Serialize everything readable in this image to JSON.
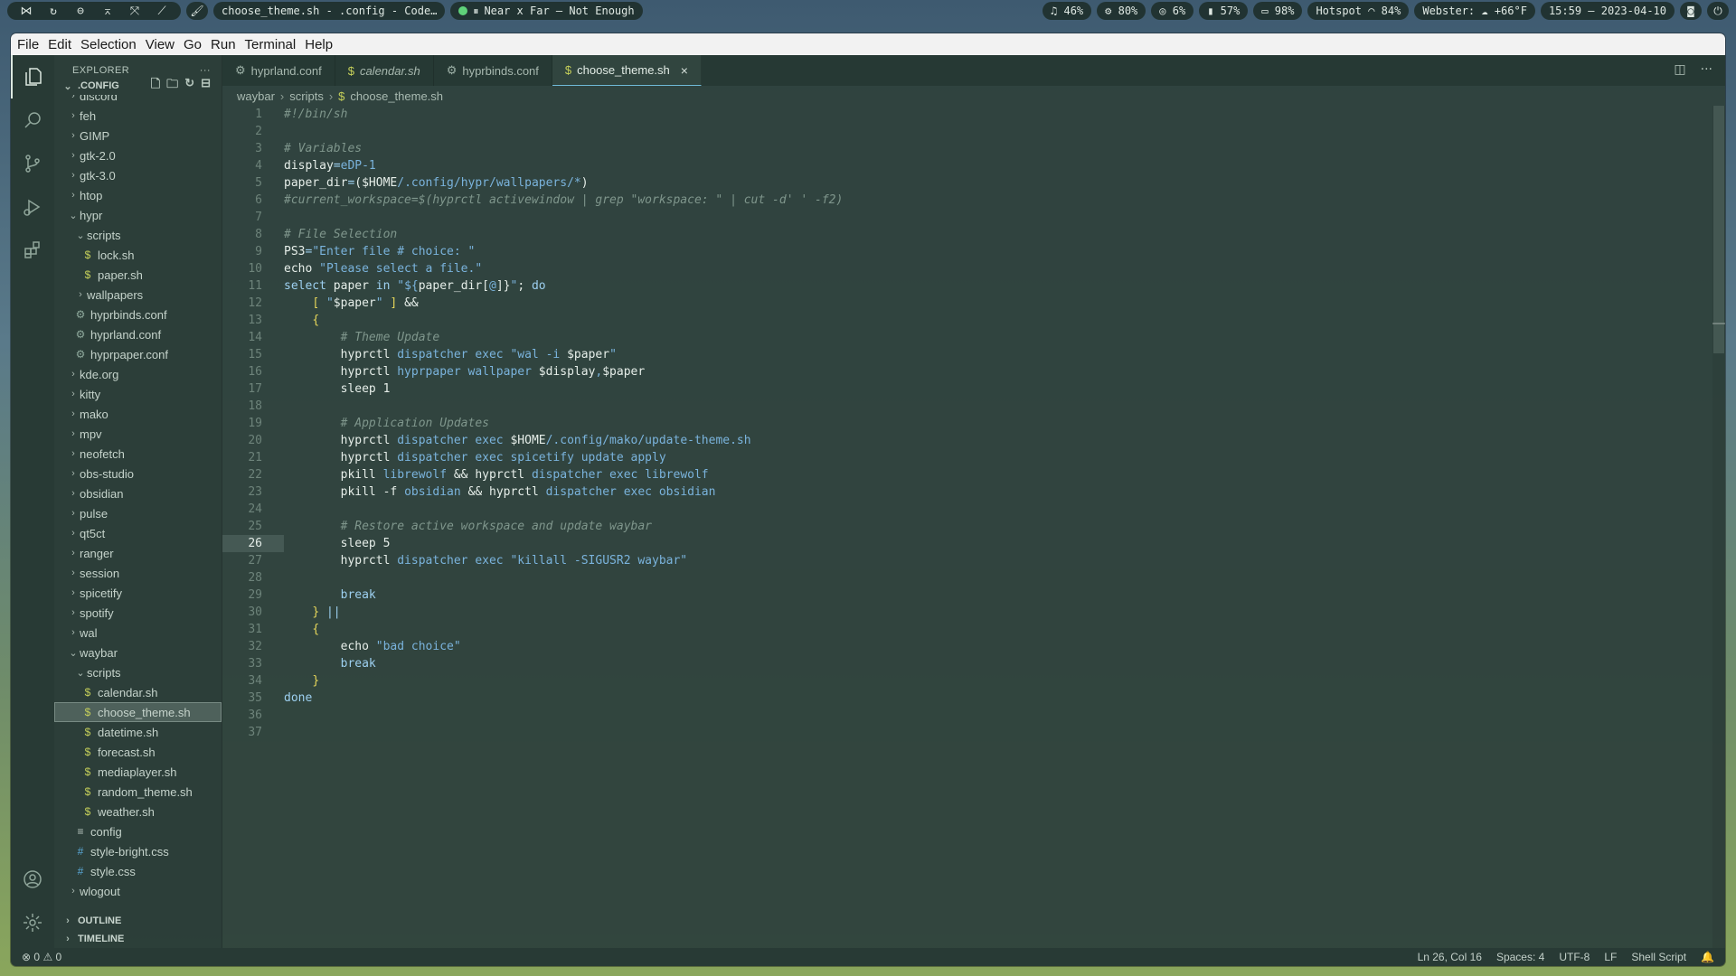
{
  "topbar": {
    "left_icons": [
      "arch-logo-icon",
      "refresh-icon",
      "spotify-icon",
      "tool-icon",
      "tools-icon",
      "pen-icon"
    ],
    "brush_icon": "brush-icon",
    "window_title": "choose_theme.sh - .config - Code…",
    "media_label": "Near x Far – Not Enough",
    "status": [
      {
        "icon": "headphones-icon",
        "label": "♫ 46%"
      },
      {
        "icon": "cpu-icon",
        "label": "⚙ 80%"
      },
      {
        "icon": "gpu-icon",
        "label": "◎ 6%"
      },
      {
        "icon": "memory-icon",
        "label": "▮ 57%"
      },
      {
        "icon": "battery-icon",
        "label": "▭ 98%"
      },
      {
        "icon": "wifi-icon",
        "label": "Hotspot ◠ 84%"
      },
      {
        "icon": "weather-icon",
        "label": "Webster: ☁ +66°F"
      },
      {
        "icon": "clock-icon",
        "label": "15:59 – 2023-04-10"
      }
    ],
    "discord_icon": "discord-icon",
    "power_icon": "power-icon"
  },
  "menu": [
    "File",
    "Edit",
    "Selection",
    "View",
    "Go",
    "Run",
    "Terminal",
    "Help"
  ],
  "sidebar": {
    "title": "EXPLORER",
    "root": ".CONFIG",
    "tree": [
      {
        "label": "discord",
        "type": "folder",
        "indent": 0,
        "open": false
      },
      {
        "label": "feh",
        "type": "folder",
        "indent": 0,
        "open": false
      },
      {
        "label": "GIMP",
        "type": "folder",
        "indent": 0,
        "open": false
      },
      {
        "label": "gtk-2.0",
        "type": "folder",
        "indent": 0,
        "open": false
      },
      {
        "label": "gtk-3.0",
        "type": "folder",
        "indent": 0,
        "open": false
      },
      {
        "label": "htop",
        "type": "folder",
        "indent": 0,
        "open": false
      },
      {
        "label": "hypr",
        "type": "folder",
        "indent": 0,
        "open": true
      },
      {
        "label": "scripts",
        "type": "folder",
        "indent": 1,
        "open": true
      },
      {
        "label": "lock.sh",
        "type": "sh",
        "indent": 2
      },
      {
        "label": "paper.sh",
        "type": "sh",
        "indent": 2
      },
      {
        "label": "wallpapers",
        "type": "folder",
        "indent": 1,
        "open": false
      },
      {
        "label": "hyprbinds.conf",
        "type": "conf",
        "indent": 1
      },
      {
        "label": "hyprland.conf",
        "type": "conf",
        "indent": 1
      },
      {
        "label": "hyprpaper.conf",
        "type": "conf",
        "indent": 1
      },
      {
        "label": "kde.org",
        "type": "folder",
        "indent": 0,
        "open": false
      },
      {
        "label": "kitty",
        "type": "folder",
        "indent": 0,
        "open": false
      },
      {
        "label": "mako",
        "type": "folder",
        "indent": 0,
        "open": false
      },
      {
        "label": "mpv",
        "type": "folder",
        "indent": 0,
        "open": false
      },
      {
        "label": "neofetch",
        "type": "folder",
        "indent": 0,
        "open": false
      },
      {
        "label": "obs-studio",
        "type": "folder",
        "indent": 0,
        "open": false
      },
      {
        "label": "obsidian",
        "type": "folder",
        "indent": 0,
        "open": false
      },
      {
        "label": "pulse",
        "type": "folder",
        "indent": 0,
        "open": false
      },
      {
        "label": "qt5ct",
        "type": "folder",
        "indent": 0,
        "open": false
      },
      {
        "label": "ranger",
        "type": "folder",
        "indent": 0,
        "open": false
      },
      {
        "label": "session",
        "type": "folder",
        "indent": 0,
        "open": false
      },
      {
        "label": "spicetify",
        "type": "folder",
        "indent": 0,
        "open": false
      },
      {
        "label": "spotify",
        "type": "folder",
        "indent": 0,
        "open": false
      },
      {
        "label": "wal",
        "type": "folder",
        "indent": 0,
        "open": false
      },
      {
        "label": "waybar",
        "type": "folder",
        "indent": 0,
        "open": true
      },
      {
        "label": "scripts",
        "type": "folder",
        "indent": 1,
        "open": true
      },
      {
        "label": "calendar.sh",
        "type": "sh",
        "indent": 2
      },
      {
        "label": "choose_theme.sh",
        "type": "sh",
        "indent": 2,
        "selected": true
      },
      {
        "label": "datetime.sh",
        "type": "sh",
        "indent": 2
      },
      {
        "label": "forecast.sh",
        "type": "sh",
        "indent": 2
      },
      {
        "label": "mediaplayer.sh",
        "type": "sh",
        "indent": 2
      },
      {
        "label": "random_theme.sh",
        "type": "sh",
        "indent": 2
      },
      {
        "label": "weather.sh",
        "type": "sh",
        "indent": 2
      },
      {
        "label": "config",
        "type": "txt",
        "indent": 1
      },
      {
        "label": "style-bright.css",
        "type": "css",
        "indent": 1
      },
      {
        "label": "style.css",
        "type": "css",
        "indent": 1
      },
      {
        "label": "wlogout",
        "type": "folder",
        "indent": 0,
        "open": false
      }
    ],
    "outline": "OUTLINE",
    "timeline": "TIMELINE"
  },
  "tabs": [
    {
      "label": "hyprland.conf",
      "icon": "gear",
      "italic": false,
      "active": false
    },
    {
      "label": "calendar.sh",
      "icon": "sh",
      "italic": true,
      "active": false
    },
    {
      "label": "hyprbinds.conf",
      "icon": "gear",
      "italic": false,
      "active": false
    },
    {
      "label": "choose_theme.sh",
      "icon": "sh",
      "italic": false,
      "active": true
    }
  ],
  "breadcrumb": [
    "waybar",
    "scripts",
    "choose_theme.sh"
  ],
  "editor": {
    "current_line": 26,
    "lines": [
      [
        [
          "cm",
          "#!/bin/sh"
        ]
      ],
      [],
      [
        [
          "cm",
          "# Variables"
        ]
      ],
      [
        [
          "wh",
          "display"
        ],
        [
          "kw",
          "="
        ],
        [
          "str",
          "eDP-1"
        ]
      ],
      [
        [
          "wh",
          "paper_dir"
        ],
        [
          "kw",
          "="
        ],
        [
          "wh",
          "($HOME"
        ],
        [
          "str",
          "/.config/hypr/wallpapers/*"
        ],
        [
          "wh",
          ")"
        ]
      ],
      [
        [
          "cm",
          "#current_workspace=$(hyprctl activewindow | grep \"workspace: \" | cut -d' ' -f2)"
        ]
      ],
      [],
      [
        [
          "cm",
          "# File Selection"
        ]
      ],
      [
        [
          "wh",
          "PS3"
        ],
        [
          "kw",
          "="
        ],
        [
          "str",
          "\"Enter file # choice: \""
        ]
      ],
      [
        [
          "wh",
          "echo "
        ],
        [
          "str",
          "\"Please select a file.\""
        ]
      ],
      [
        [
          "kw",
          "select "
        ],
        [
          "wh",
          "paper "
        ],
        [
          "kw",
          "in "
        ],
        [
          "str",
          "\"${"
        ],
        [
          "wh",
          "paper_dir["
        ],
        [
          "str",
          "@"
        ],
        [
          "wh",
          "]}"
        ],
        [
          "str",
          "\""
        ],
        [
          "wh",
          "; "
        ],
        [
          "kw",
          "do"
        ]
      ],
      [
        [
          "wh",
          "    "
        ],
        [
          "br",
          "[ "
        ],
        [
          "str",
          "\""
        ],
        [
          "wh",
          "$paper"
        ],
        [
          "str",
          "\""
        ],
        [
          "br",
          " ]"
        ],
        [
          "wh",
          " &&"
        ]
      ],
      [
        [
          "wh",
          "    "
        ],
        [
          "br",
          "{"
        ]
      ],
      [
        [
          "wh",
          "        "
        ],
        [
          "cm",
          "# Theme Update"
        ]
      ],
      [
        [
          "wh",
          "        hyprctl "
        ],
        [
          "str",
          "dispatcher exec "
        ],
        [
          "str",
          "\"wal -i "
        ],
        [
          "wh",
          "$paper"
        ],
        [
          "str",
          "\""
        ]
      ],
      [
        [
          "wh",
          "        hyprctl "
        ],
        [
          "str",
          "hyprpaper wallpaper "
        ],
        [
          "wh",
          "$display"
        ],
        [
          "str",
          ","
        ],
        [
          "wh",
          "$paper"
        ]
      ],
      [
        [
          "wh",
          "        sleep 1"
        ]
      ],
      [],
      [
        [
          "wh",
          "        "
        ],
        [
          "cm",
          "# Application Updates"
        ]
      ],
      [
        [
          "wh",
          "        hyprctl "
        ],
        [
          "str",
          "dispatcher exec "
        ],
        [
          "wh",
          "$HOME"
        ],
        [
          "str",
          "/.config/mako/update-theme.sh"
        ]
      ],
      [
        [
          "wh",
          "        hyprctl "
        ],
        [
          "str",
          "dispatcher exec spicetify update apply"
        ]
      ],
      [
        [
          "wh",
          "        pkill "
        ],
        [
          "str",
          "librewolf "
        ],
        [
          "wh",
          "&& hyprctl "
        ],
        [
          "str",
          "dispatcher exec librewolf"
        ]
      ],
      [
        [
          "wh",
          "        pkill -f "
        ],
        [
          "str",
          "obsidian "
        ],
        [
          "wh",
          "&& hyprctl "
        ],
        [
          "str",
          "dispatcher exec obsidian"
        ]
      ],
      [],
      [
        [
          "wh",
          "        "
        ],
        [
          "cm",
          "# Restore active workspace and update waybar"
        ]
      ],
      [
        [
          "wh",
          "        sleep 5"
        ]
      ],
      [
        [
          "wh",
          "        hyprctl "
        ],
        [
          "str",
          "dispatcher exec "
        ],
        [
          "str",
          "\"killall -SIGUSR2 waybar\""
        ]
      ],
      [],
      [
        [
          "wh",
          "        "
        ],
        [
          "kw",
          "break"
        ]
      ],
      [
        [
          "wh",
          "    "
        ],
        [
          "br",
          "}"
        ],
        [
          "kw",
          " ||"
        ]
      ],
      [
        [
          "wh",
          "    "
        ],
        [
          "br",
          "{"
        ]
      ],
      [
        [
          "wh",
          "        echo "
        ],
        [
          "str",
          "\"bad choice\""
        ]
      ],
      [
        [
          "wh",
          "        "
        ],
        [
          "kw",
          "break"
        ]
      ],
      [
        [
          "wh",
          "    "
        ],
        [
          "br",
          "}"
        ]
      ],
      [
        [
          "kw",
          "done"
        ]
      ],
      [],
      []
    ]
  },
  "statusbar": {
    "errors": "0",
    "warnings": "0",
    "position": "Ln 26, Col 16",
    "spaces": "Spaces: 4",
    "encoding": "UTF-8",
    "eol": "LF",
    "language": "Shell Script"
  }
}
